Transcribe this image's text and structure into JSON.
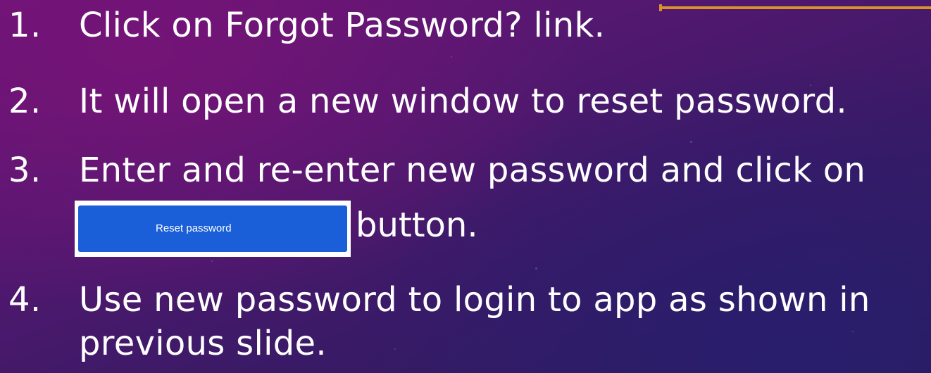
{
  "steps": [
    {
      "number": "1.",
      "text": "Click on Forgot Password? link."
    },
    {
      "number": "2.",
      "text": "It will open a new window to reset password."
    },
    {
      "number": "3.",
      "text": "Enter and re-enter new password and click on"
    },
    {
      "number": "4.",
      "text": "Use new password to login to app as shown in"
    }
  ],
  "step3_continuation": "button.",
  "step4_continuation": "previous slide.",
  "reset_button_label": "Reset password",
  "colors": {
    "accent": "#d9922a",
    "button": "#1a5fd8",
    "text": "#ffffff"
  }
}
